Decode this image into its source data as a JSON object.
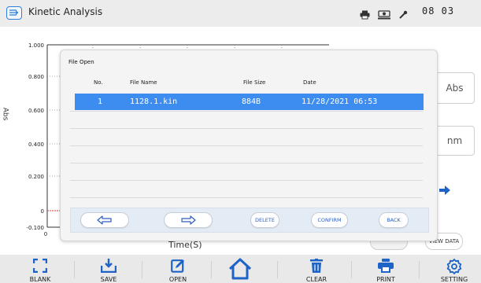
{
  "header": {
    "title": "Kinetic Analysis",
    "clock": "08 03"
  },
  "chart_data": {
    "type": "line",
    "y_tick_labels": [
      "1.000",
      "0.800",
      "0.600",
      "0.400",
      "0.200",
      "0",
      "-0.100"
    ],
    "x_tick_labels": [
      "0"
    ],
    "ylabel": "Abs",
    "xlabel": "Time(S)",
    "ylim": [
      -0.1,
      1.0
    ],
    "grid": true,
    "series": []
  },
  "side_panel": {
    "abs_label": "Abs",
    "nm_label": "nm",
    "view_data_label": "VIEW DATA"
  },
  "dialog": {
    "title": "File Open",
    "columns": [
      "No.",
      "File Name",
      "File Size",
      "Date"
    ],
    "rows": [
      {
        "no": "1",
        "file_name": "1128.1.kin",
        "file_size": "884B",
        "date": "11/28/2021 06:53",
        "selected": true
      }
    ],
    "buttons": {
      "delete": "DELETE",
      "confirm": "CONFIRM",
      "back": "BACK"
    },
    "colors": {
      "selected_row": "#3d8df0",
      "button_text": "#2b5fc0"
    }
  },
  "toolbar": {
    "items": [
      {
        "label": "BLANK",
        "icon": "blank-frame-icon"
      },
      {
        "label": "SAVE",
        "icon": "save-download-icon"
      },
      {
        "label": "OPEN",
        "icon": "open-edit-icon"
      },
      {
        "label": "",
        "icon": "home-icon"
      },
      {
        "label": "CLEAR",
        "icon": "trash-icon"
      },
      {
        "label": "PRINT",
        "icon": "printer-icon"
      },
      {
        "label": "SETTING",
        "icon": "gear-icon"
      }
    ]
  },
  "colors": {
    "accent": "#2f7fd8",
    "chart_red_line": "#e03a3a"
  }
}
